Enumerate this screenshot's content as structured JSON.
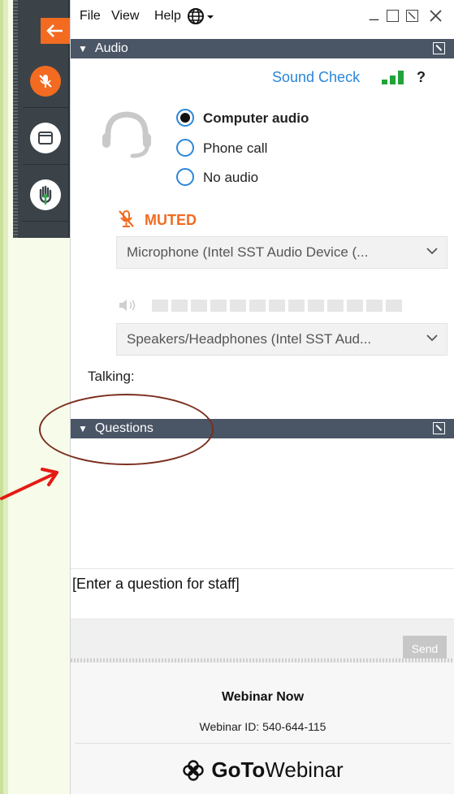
{
  "menubar": {
    "items": [
      "File",
      "View",
      "Help"
    ],
    "window_controls": [
      "minimize",
      "restore",
      "popout",
      "close"
    ]
  },
  "audio": {
    "section_title": "Audio",
    "sound_check": "Sound Check",
    "sound_check_help": "?",
    "options": [
      {
        "label": "Computer audio",
        "selected": true
      },
      {
        "label": "Phone call",
        "selected": false
      },
      {
        "label": "No audio",
        "selected": false
      }
    ],
    "mute_status": "MUTED",
    "microphone": "Microphone (Intel SST Audio Device (...",
    "speakers": "Speakers/Headphones (Intel SST Aud...",
    "talking_label": "Talking:"
  },
  "questions": {
    "section_title": "Questions",
    "input_placeholder": "[Enter a question for staff]",
    "send_label": "Send"
  },
  "footer": {
    "webinar_title": "Webinar Now",
    "webinar_id": "Webinar ID: 540-644-115",
    "brand_bold": "GoTo",
    "brand_light": "Webinar"
  },
  "icons": {
    "back": "arrow-left-icon",
    "mic": "microphone-muted-icon",
    "screen": "screen-window-icon",
    "hand": "raise-hand-icon",
    "headset": "headset-icon",
    "speaker": "speaker-icon",
    "globe": "globe-icon",
    "brand_logo": "gotowebinar-logo-icon"
  },
  "colors": {
    "accent_orange": "#f26b21",
    "header_bar": "#4a5566",
    "link_blue": "#2a86d9",
    "meter_green": "#22a33a",
    "annotation": "#7b2e1e",
    "arrow_red": "#e41b13"
  }
}
